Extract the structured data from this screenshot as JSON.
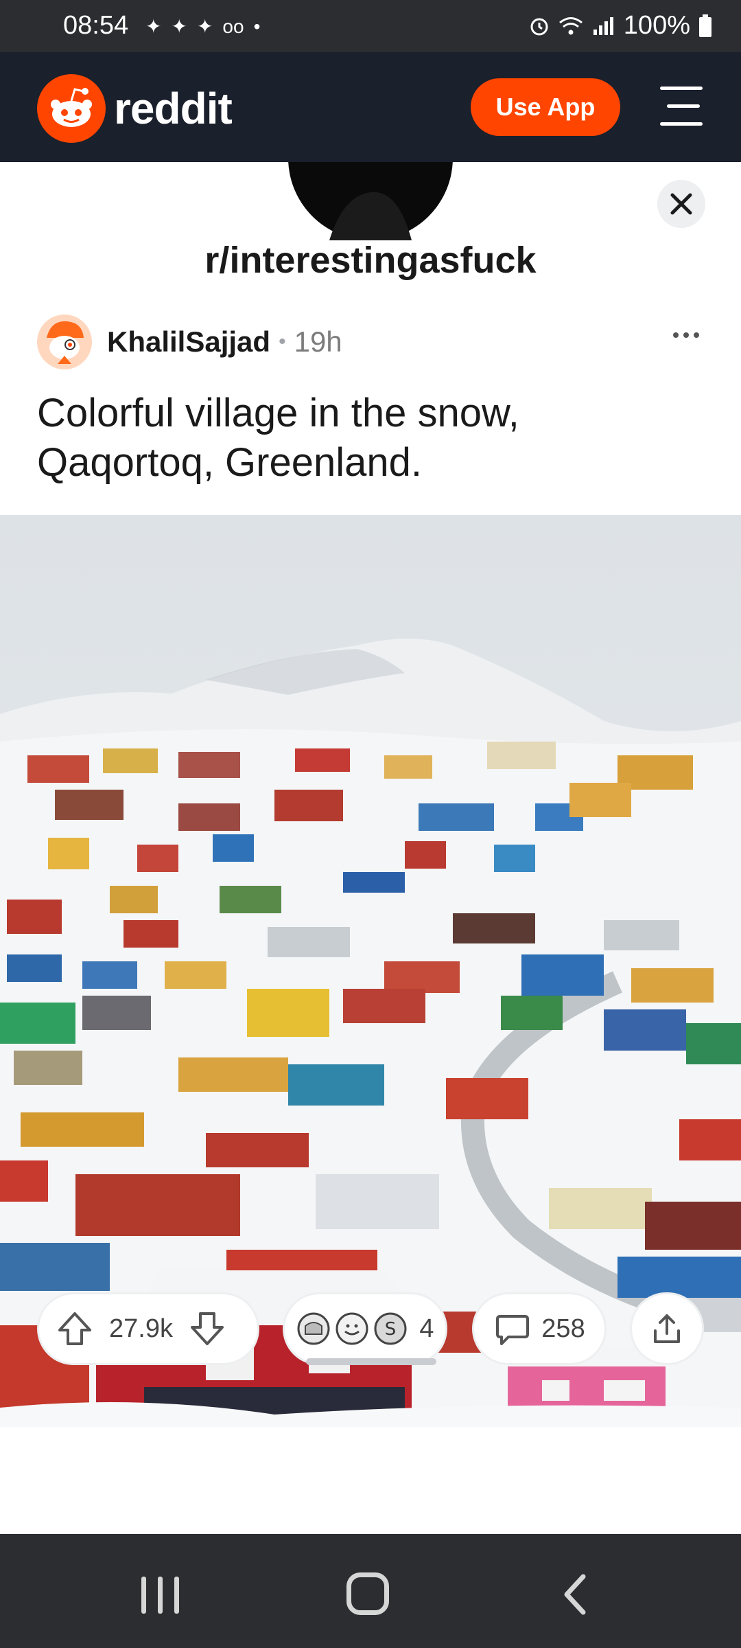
{
  "status_bar": {
    "time": "08:54",
    "battery": "100%",
    "notification_icons": [
      "app-icon",
      "app-icon",
      "app-icon",
      "voicemail-icon",
      "dot-icon"
    ],
    "system_icons": [
      "alarm-icon",
      "wifi-icon",
      "signal-icon",
      "battery-icon"
    ]
  },
  "header": {
    "brand": "reddit",
    "use_app_label": "Use App",
    "accent_color": "#ff4500",
    "background_color": "#1a202c"
  },
  "post": {
    "subreddit": "r/interestingasfuck",
    "author": "KhalilSajjad",
    "separator": "•",
    "age": "19h",
    "title": "Colorful village in the snow, Qaqortoq, Greenland."
  },
  "actions": {
    "vote_count": "27.9k",
    "award_count": "4",
    "comment_count": "258"
  },
  "nav_bar": {
    "buttons": [
      "recents-icon",
      "home-icon",
      "back-icon"
    ]
  }
}
